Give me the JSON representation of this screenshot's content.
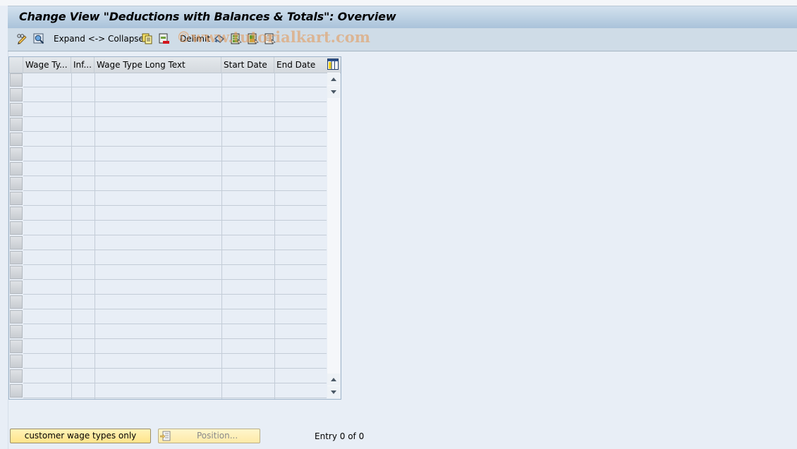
{
  "window": {
    "title": "Change View \"Deductions with Balances & Totals\": Overview"
  },
  "toolbar": {
    "items": [
      {
        "icon": "display-change-icon"
      },
      {
        "icon": "find-icon"
      },
      {
        "label": "Expand <-> Collapse"
      },
      {
        "icon": "copy-as-icon"
      },
      {
        "icon": "delete-icon"
      },
      {
        "label": "Delimit"
      },
      {
        "icon": "undo-change-icon"
      },
      {
        "icon": "select-all-icon"
      },
      {
        "icon": "select-block-icon"
      },
      {
        "icon": "deselect-all-icon"
      }
    ],
    "expand_label": "Expand <-> Collapse",
    "delimit_label": "Delimit"
  },
  "watermark": "©www.tutorialkart.com",
  "table": {
    "columns": [
      {
        "label": "Wage Ty..."
      },
      {
        "label": "Inf..."
      },
      {
        "label": "Wage Type Long Text"
      },
      {
        "label": "Start Date"
      },
      {
        "label": "End Date"
      }
    ],
    "rows": [],
    "visible_empty_rows": 22
  },
  "footer": {
    "customer_button": "customer wage types only",
    "position_button": "Position...",
    "entry_text": "Entry 0 of 0"
  }
}
